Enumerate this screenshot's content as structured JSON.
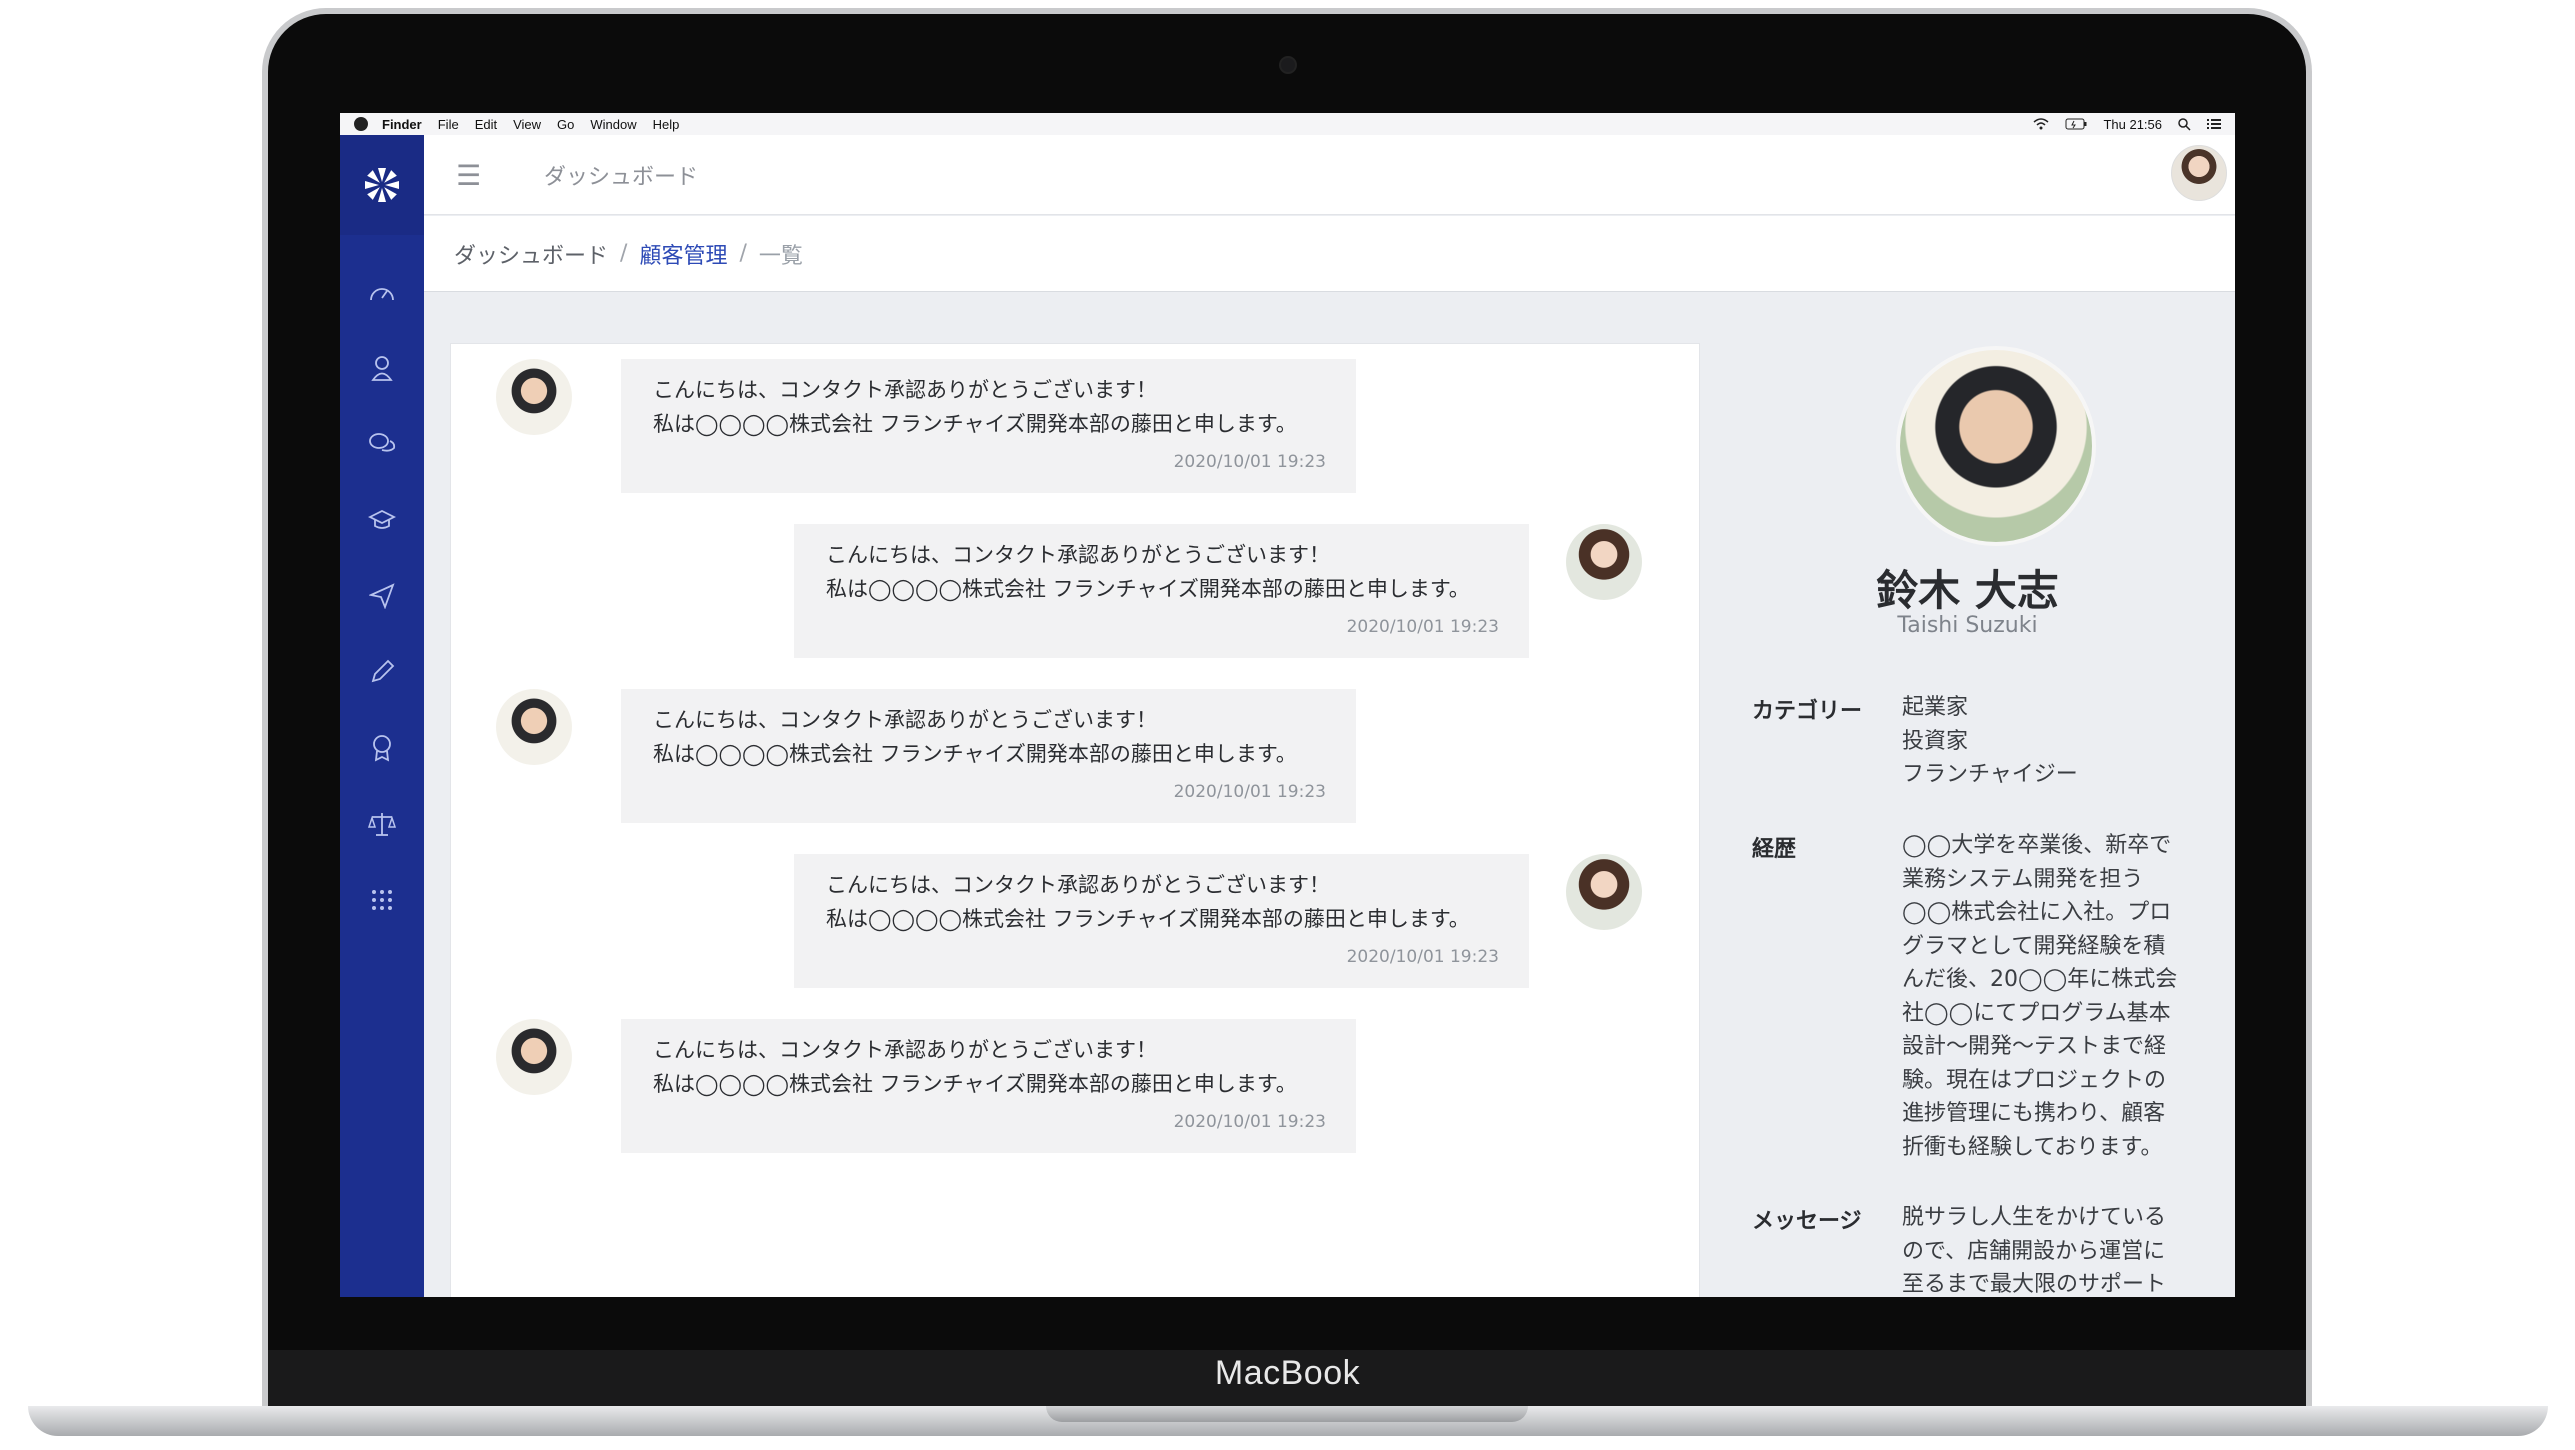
{
  "device": {
    "brand": "MacBook"
  },
  "menubar": {
    "app": "Finder",
    "items": [
      "File",
      "Edit",
      "View",
      "Go",
      "Window",
      "Help"
    ],
    "clock": "Thu 21:56"
  },
  "header": {
    "title": "ダッシュボード"
  },
  "breadcrumb": {
    "home": "ダッシュボード",
    "section": "顧客管理",
    "current": "一覧",
    "sep": "/"
  },
  "messages": [
    {
      "side": "left",
      "line1": "こんにちは、コンタクト承認ありがとうございます！",
      "line2": "私は◯◯◯◯株式会社 フランチャイズ開発本部の藤田と申します。",
      "time": "2020/10/01 19:23"
    },
    {
      "side": "right",
      "line1": "こんにちは、コンタクト承認ありがとうございます！",
      "line2": "私は◯◯◯◯株式会社 フランチャイズ開発本部の藤田と申します。",
      "time": "2020/10/01 19:23"
    },
    {
      "side": "left",
      "line1": "こんにちは、コンタクト承認ありがとうございます！",
      "line2": "私は◯◯◯◯株式会社 フランチャイズ開発本部の藤田と申します。",
      "time": "2020/10/01 19:23"
    },
    {
      "side": "right",
      "line1": "こんにちは、コンタクト承認ありがとうございます！",
      "line2": "私は◯◯◯◯株式会社 フランチャイズ開発本部の藤田と申します。",
      "time": "2020/10/01 19:23"
    },
    {
      "side": "left",
      "line1": "こんにちは、コンタクト承認ありがとうございます！",
      "line2": "私は◯◯◯◯株式会社 フランチャイズ開発本部の藤田と申します。",
      "time": "2020/10/01 19:23"
    }
  ],
  "profile": {
    "name": "鈴木 大志",
    "name_roman": "Taishi Suzuki",
    "category_label": "カテゴリー",
    "categories": [
      "起業家",
      "投資家",
      "フランチャイジー"
    ],
    "career_label": "経歴",
    "career_lines": [
      "◯◯大学を卒業後、新卒で",
      "業務システム開発を担う",
      "◯◯株式会社に入社。プロ",
      "グラマとして開発経験を積",
      "んだ後、20◯◯年に株式会",
      "社◯◯にてプログラム基本",
      "設計〜開発〜テストまで経",
      "験。現在はプロジェクトの",
      "進捗管理にも携わり、顧客",
      "折衝も経験しております。"
    ],
    "message_label": "メッセージ",
    "message_lines": [
      "脱サラし人生をかけている",
      "ので、店舗開設から運営に",
      "至るまで最大限のサポート"
    ]
  },
  "icons": {
    "sidebar": [
      "dashboard-icon",
      "user-icon",
      "chat-icon",
      "graduation-cap-icon",
      "send-icon",
      "pencil-icon",
      "award-icon",
      "scale-icon",
      "grid-icon"
    ],
    "colors": {
      "sidebar": "#1c2f8f",
      "link": "#2d4ab6"
    }
  }
}
